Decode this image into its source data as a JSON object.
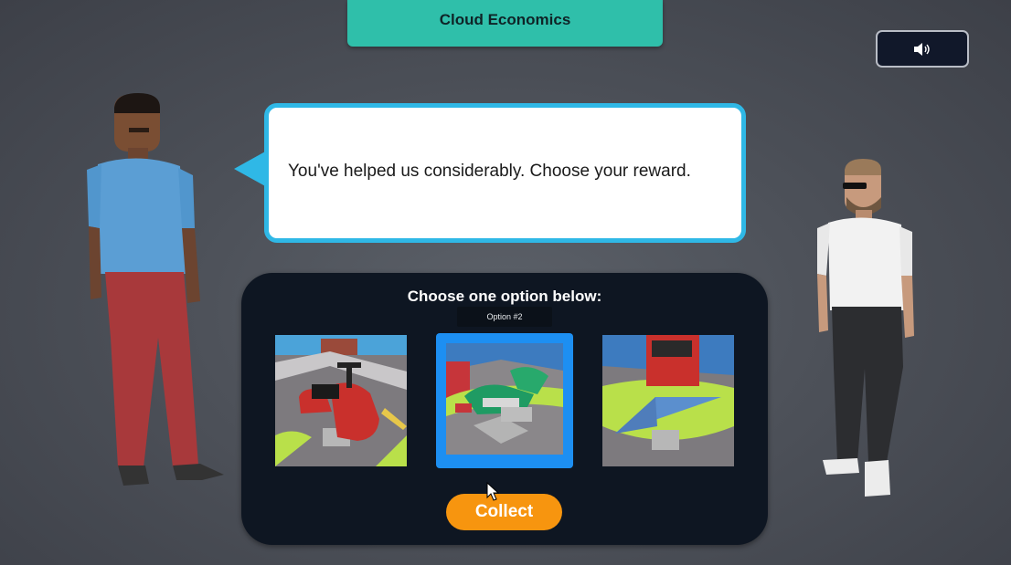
{
  "header": {
    "title": "Cloud Economics"
  },
  "sound_button": {
    "icon": "speaker-icon"
  },
  "dialog": {
    "text": "You've helped us considerably. Choose your reward."
  },
  "reward_panel": {
    "heading": "Choose one option below:",
    "tooltip": "Option #2",
    "options": [
      {
        "icon": "red-scooter-image",
        "selected": false
      },
      {
        "icon": "green-motorcycle-image",
        "selected": true
      },
      {
        "icon": "blue-paper-plane-image",
        "selected": false
      }
    ],
    "collect_label": "Collect"
  },
  "colors": {
    "title_bar": "#2fbfaa",
    "bubble_border": "#2fb8e6",
    "panel_bg": "#0e1622",
    "selected_border": "#1d8ff2",
    "collect_button": "#f7950f"
  }
}
